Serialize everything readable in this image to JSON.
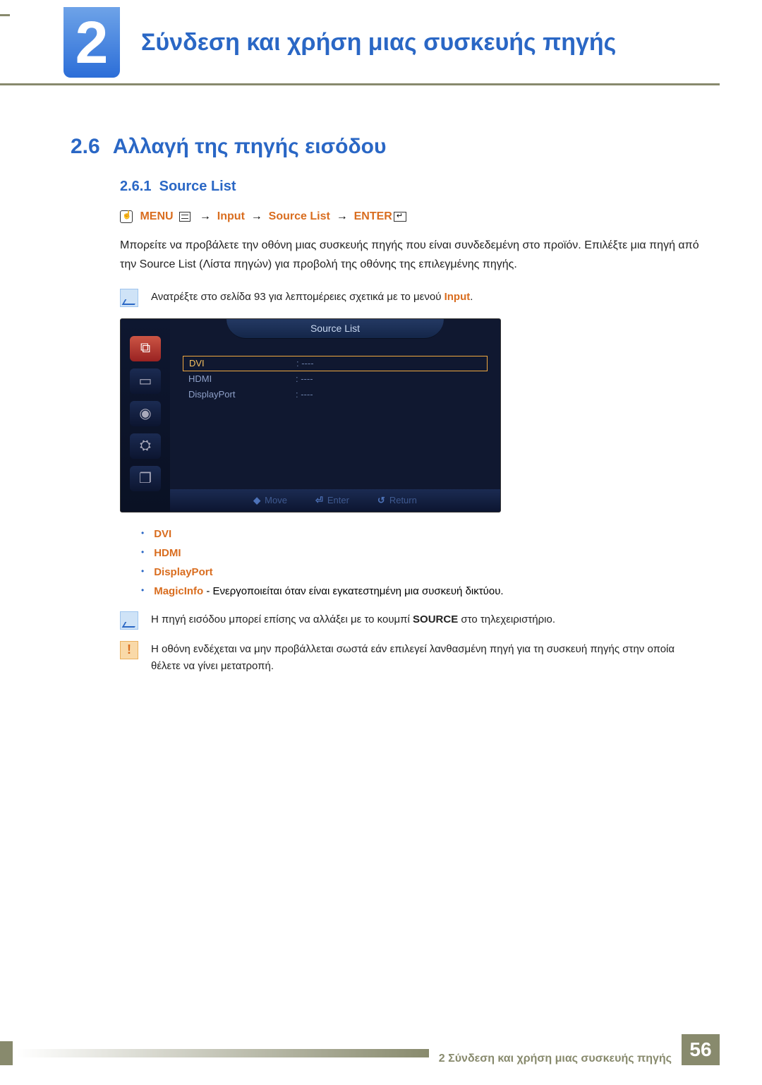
{
  "chapter": {
    "number": "2",
    "title": "Σύνδεση και χρήση μιας συσκευής πηγής"
  },
  "section": {
    "number": "2.6",
    "title": "Αλλαγή της πηγής εισόδου"
  },
  "subsection": {
    "number": "2.6.1",
    "title": "Source List"
  },
  "menu_path": {
    "menu": "MENU",
    "arrow": "→",
    "input": "Input",
    "source_list": "Source List",
    "enter": "ENTER"
  },
  "paragraph": "Μπορείτε να προβάλετε την οθόνη μιας συσκευής πηγής που είναι συνδεδεμένη στο προϊόν. Επιλέξτε μια πηγή από την Source List (Λίστα πηγών) για προβολή της οθόνης της επιλεγμένης πηγής.",
  "note1": {
    "pre": "Ανατρέξτε στο σελίδα 93 για λεπτομέρειες σχετικά με το μενού ",
    "kw": "Input",
    "post": "."
  },
  "osd": {
    "title": "Source List",
    "rows": [
      {
        "label": "DVI",
        "value": ": ----",
        "selected": true
      },
      {
        "label": "HDMI",
        "value": ": ----",
        "selected": false
      },
      {
        "label": "DisplayPort",
        "value": ": ----",
        "selected": false
      }
    ],
    "footer": {
      "move": "Move",
      "enter": "Enter",
      "return": "Return"
    }
  },
  "bullets": {
    "b1": "DVI",
    "b2": "HDMI",
    "b3": "DisplayPort",
    "b4_kw": "MagicInfo",
    "b4_rest": " - Ενεργοποιείται όταν είναι εγκατεστημένη μια συσκευή δικτύου."
  },
  "note2": {
    "pre": "Η πηγή εισόδου μπορεί επίσης να αλλάξει με το κουμπί ",
    "kw": "SOURCE",
    "post": " στο τηλεχειριστήριο."
  },
  "warning": "Η οθόνη ενδέχεται να μην προβάλλεται σωστά εάν επιλεγεί λανθασμένη πηγή για τη συσκευή πηγής στην οποία θέλετε να γίνει μετατροπή.",
  "footer": {
    "text": "2 Σύνδεση και χρήση μιας συσκευής πηγής",
    "page": "56"
  }
}
